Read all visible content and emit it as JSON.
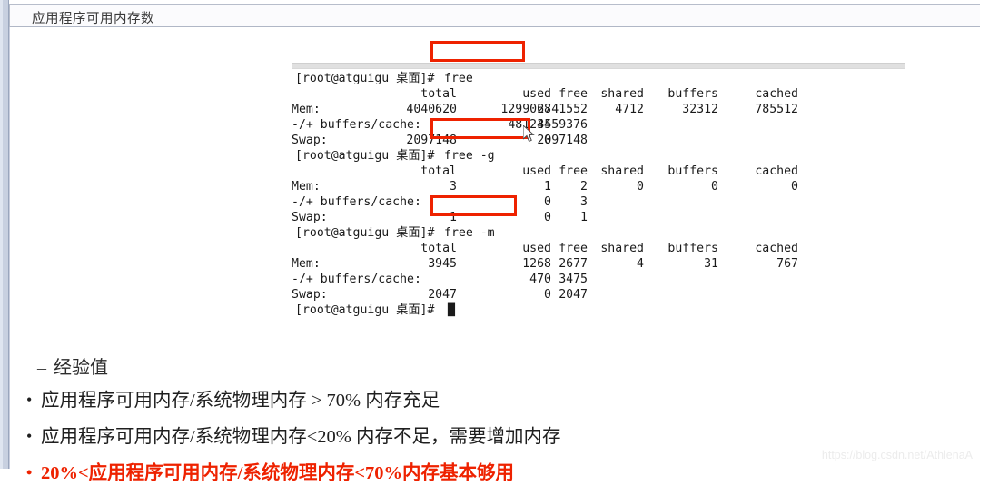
{
  "window": {
    "title": "应用程序可用内存数"
  },
  "terminal": {
    "prompt": "[root@atguigu 桌面]#",
    "headers": {
      "total": "total",
      "used": "used",
      "free": "free",
      "shared": "shared",
      "buffers": "buffers",
      "cached": "cached"
    },
    "row_labels": {
      "mem": "Mem:",
      "buffers_cache": "-/+ buffers/cache:",
      "swap": "Swap:"
    },
    "blocks": [
      {
        "command": "free",
        "highlighted": true,
        "mem": {
          "total": "4040620",
          "used": "1299068",
          "free": "2741552",
          "shared": "4712",
          "buffers": "32312",
          "cached": "785512"
        },
        "buffers_cache": {
          "used": "481244",
          "free": "3559376"
        },
        "swap": {
          "total": "2097148",
          "used": "0",
          "free": "2097148"
        }
      },
      {
        "command": "free -g",
        "highlighted": true,
        "mem": {
          "total": "3",
          "used": "1",
          "free": "2",
          "shared": "0",
          "buffers": "0",
          "cached": "0"
        },
        "buffers_cache": {
          "used": "0",
          "free": "3"
        },
        "swap": {
          "total": "1",
          "used": "0",
          "free": "1"
        }
      },
      {
        "command": "free -m",
        "highlighted": true,
        "mem": {
          "total": "3945",
          "used": "1268",
          "free": "2677",
          "shared": "4",
          "buffers": "31",
          "cached": "767"
        },
        "buffers_cache": {
          "used": "470",
          "free": "3475"
        },
        "swap": {
          "total": "2047",
          "used": "0",
          "free": "2047"
        }
      }
    ],
    "final_prompt": "[root@atguigu 桌面]#",
    "cursor_block": "█"
  },
  "notes": {
    "section_marker": "–",
    "section_title": "经验值",
    "bullet_marker": "•",
    "items": [
      {
        "text": "应用程序可用内存/系统物理内存 > 70% 内存充足",
        "color": "#1f1f1f",
        "emphasis": "70%"
      },
      {
        "text": "应用程序可用内存/系统物理内存<20% 内存不足，需要增加内存",
        "color": "#1f1f1f",
        "emphasis": "<20%"
      },
      {
        "text": "20%<应用程序可用内存/系统物理内存<70%内存基本够用",
        "color": "#ee2200",
        "emphasis": "20% 70%"
      }
    ]
  },
  "watermark": {
    "text": "https://blog.csdn.net/AthlenaA"
  },
  "colors": {
    "annotation_red": "#ee2200",
    "chrome_blue": "#c8d0e0",
    "terminal_text": "#1a1a1a"
  }
}
